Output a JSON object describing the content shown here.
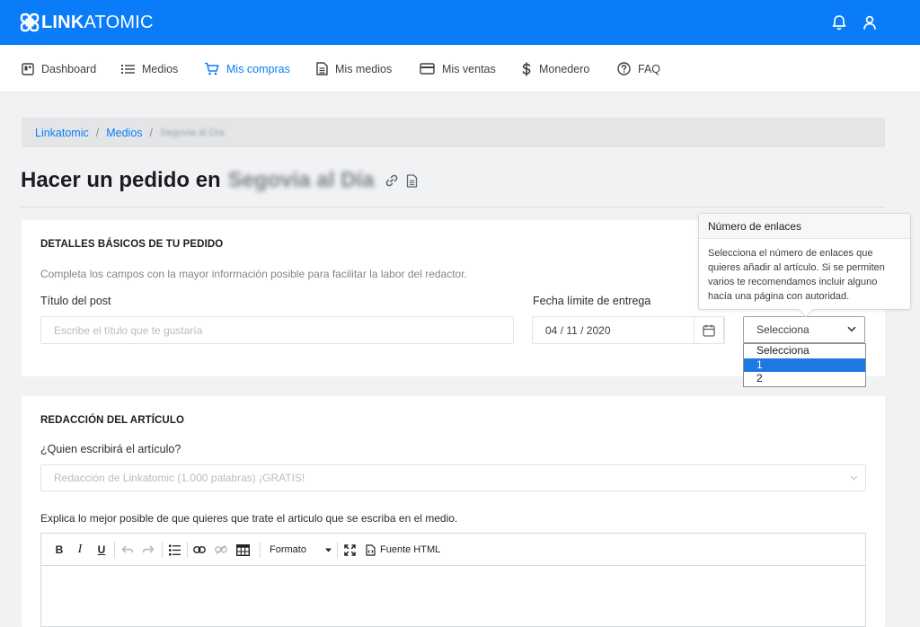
{
  "header": {
    "logo_bold": "LINK",
    "logo_light": "ATOMIC",
    "brand_color": "#0a7cf8",
    "icons": [
      "bell-icon",
      "user-icon"
    ]
  },
  "nav": {
    "items": [
      {
        "label": "Dashboard",
        "icon": "dashboard-icon"
      },
      {
        "label": "Medios",
        "icon": "list-icon"
      },
      {
        "label": "Mis compras",
        "icon": "cart-icon",
        "active": true
      },
      {
        "label": "Mis medios",
        "icon": "document-icon"
      },
      {
        "label": "Mis ventas",
        "icon": "card-icon"
      },
      {
        "label": "Monedero",
        "icon": "dollar-icon"
      },
      {
        "label": "FAQ",
        "icon": "help-icon"
      }
    ]
  },
  "breadcrumb": {
    "items": [
      "Linkatomic",
      "Medios"
    ],
    "current": "Segovia al Día"
  },
  "page": {
    "title": "Hacer un pedido en",
    "title_blurred": "Segovia al Día"
  },
  "order_details": {
    "heading": "DETALLES BÁSICOS DE TU PEDIDO",
    "subtitle": "Completa los campos con la mayor información posible para facilitar la labor del redactor.",
    "post_title_label": "Título del post",
    "post_title_placeholder": "Escribe el título que te gustaría",
    "deadline_label": "Fecha límite de entrega",
    "deadline_value": "04 / 11 / 2020",
    "links_select_value": "Selecciona",
    "links_options": [
      "Selecciona",
      "1",
      "2"
    ],
    "links_selected_option": "1"
  },
  "tooltip": {
    "title": "Número de enlaces",
    "body": "Selecciona el número de enlaces que quieres añadir al artículo. Si se permiten varios te recomendamos incluir alguno hacía una página con autoridad."
  },
  "article": {
    "heading": "REDACCIÓN DEL ARTÍCULO",
    "writer_label": "¿Quien escribirá el artículo?",
    "writer_value": "Redacción de Linkatomic (1.000 palabras) ¡GRATIS!",
    "brief_label": "Explica lo mejor posible de que quieres que trate el articulo que se escriba en el medio.",
    "toolbar": {
      "bold": "B",
      "italic": "I",
      "underline": "U",
      "format": "Formato",
      "source": "Fuente HTML"
    }
  }
}
